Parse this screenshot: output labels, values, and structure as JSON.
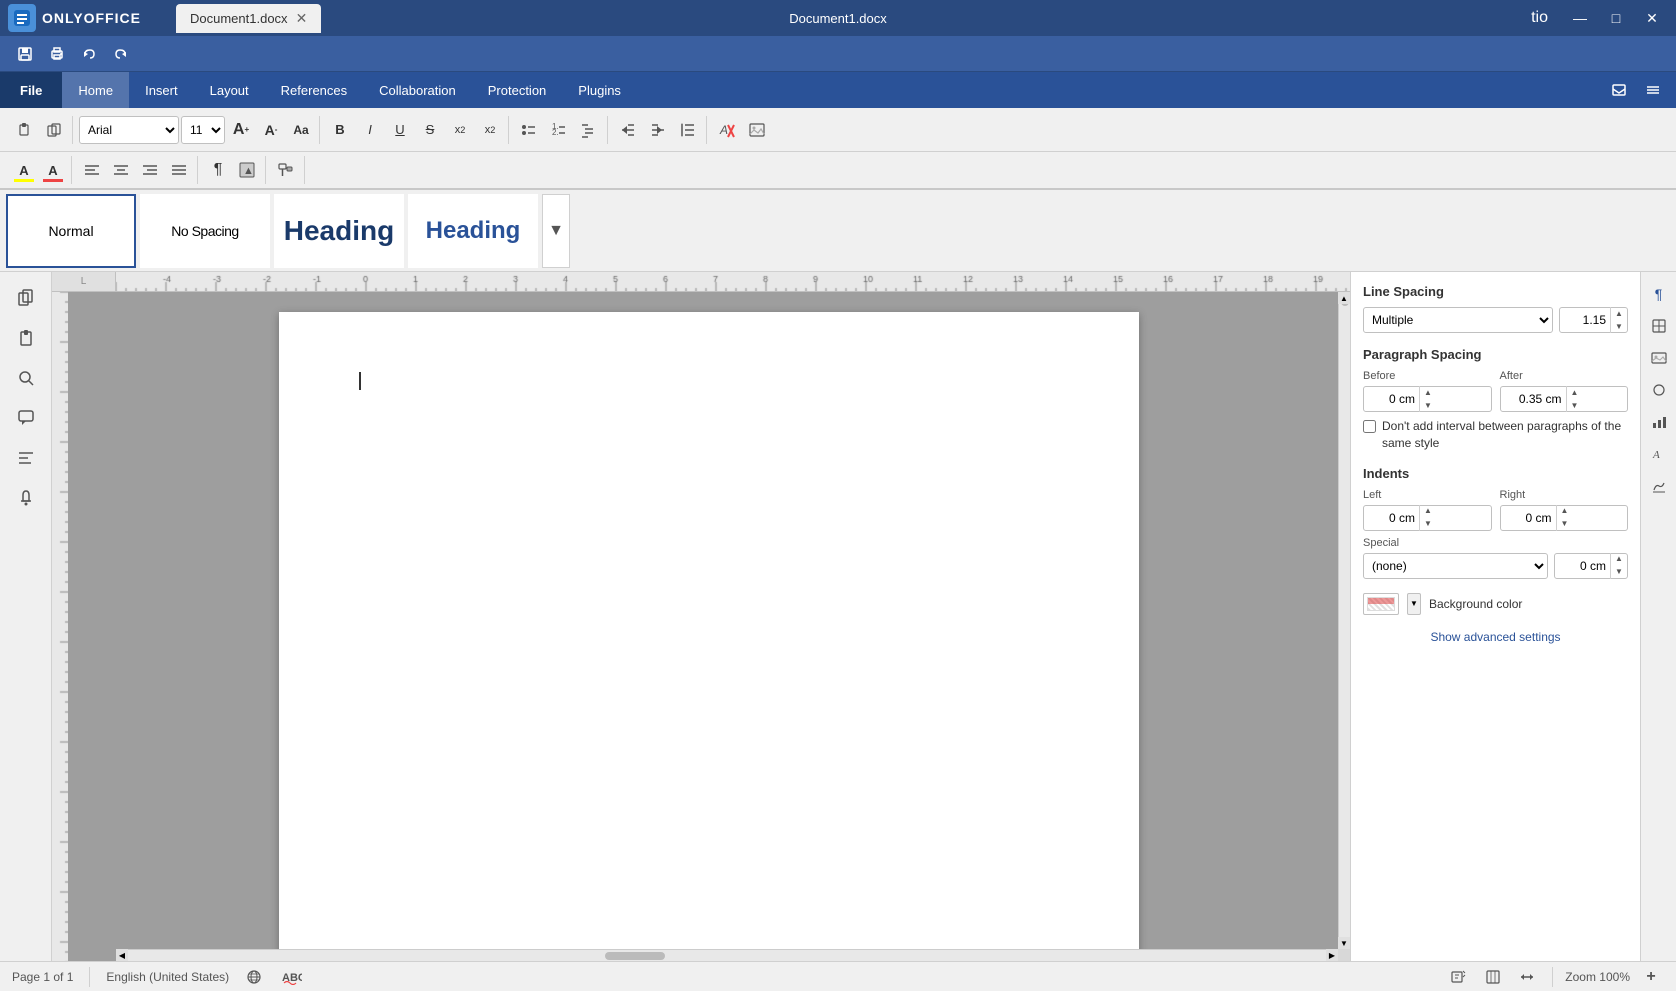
{
  "titlebar": {
    "logo_text": "ONLYOFFICE",
    "doc_tab": "Document1.docx",
    "doc_center": "Document1.docx",
    "tio": "tio",
    "win_minimize": "—",
    "win_restore": "□",
    "win_close": "✕"
  },
  "quicktoolbar": {
    "save_icon": "💾",
    "print_icon": "🖨",
    "undo_icon": "↩",
    "redo_icon": "↪"
  },
  "menubar": {
    "file": "File",
    "home": "Home",
    "insert": "Insert",
    "layout": "Layout",
    "references": "References",
    "collaboration": "Collaboration",
    "protection": "Protection",
    "plugins": "Plugins"
  },
  "ribbon": {
    "font_name": "Arial",
    "font_size": "11",
    "btn_inc": "A",
    "btn_dec": "a",
    "btn_case": "Aa",
    "btn_bold": "B",
    "btn_italic": "I",
    "btn_underline": "U",
    "btn_strike": "S",
    "btn_super": "x²",
    "btn_sub": "x₂",
    "btn_highlight": "A",
    "btn_color": "A",
    "btn_bullets": "≡",
    "btn_numbering": "≡",
    "btn_multi": "≡",
    "btn_indent_dec": "←",
    "btn_indent_inc": "→",
    "btn_line_space": "↕",
    "btn_clear": "✕",
    "btn_image": "▣"
  },
  "ribbon2": {
    "btn_align_left": "≡",
    "btn_align_center": "≡",
    "btn_align_right": "≡",
    "btn_justify": "≡",
    "btn_para": "¶",
    "btn_fill": "◼",
    "btn_paste": "📋",
    "btn_copy": "📋"
  },
  "styles": {
    "normal_label": "Normal",
    "nospacing_label": "No Spacing",
    "h1_label": "Heading",
    "h2_label": "Heading"
  },
  "rightpanel": {
    "title_line_spacing": "Line Spacing",
    "line_spacing_type": "Multiple",
    "line_spacing_value": "1.15",
    "title_para_spacing": "Paragraph Spacing",
    "before_label": "Before",
    "before_value": "0 cm",
    "after_label": "After",
    "after_value": "0.35 cm",
    "checkbox_label": "Don't add interval between paragraphs of the same style",
    "title_indents": "Indents",
    "left_label": "Left",
    "left_value": "0 cm",
    "right_label": "Right",
    "right_value": "0 cm",
    "special_label": "Special",
    "special_value": "(none)",
    "special_cm": "0 cm",
    "bg_color_label": "Background color",
    "show_advanced": "Show advanced settings"
  },
  "statusbar": {
    "page_info": "Page 1 of 1",
    "language": "English (United States)",
    "spell_btn": "ABC",
    "zoom_label": "Zoom 100%",
    "zoom_in": "+",
    "zoom_out": "−"
  }
}
